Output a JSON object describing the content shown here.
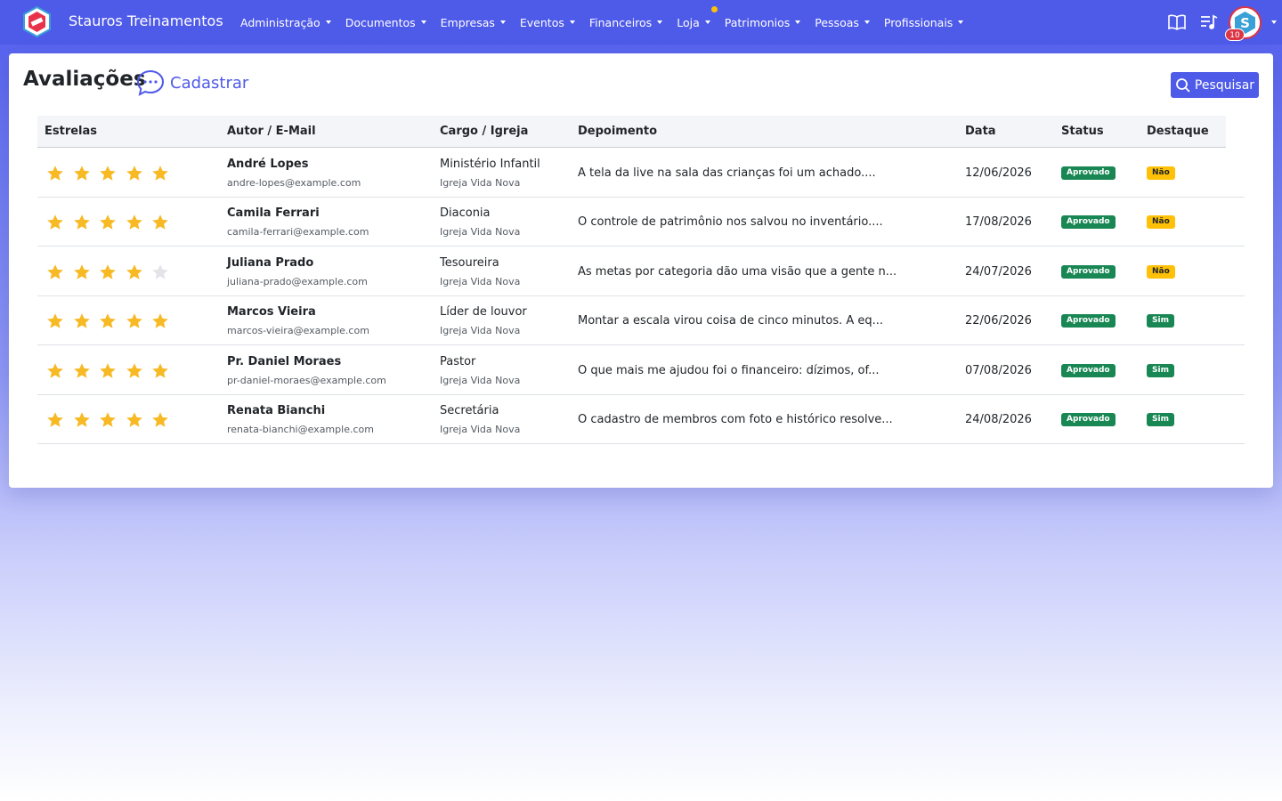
{
  "navbar": {
    "brand": "Stauros Treinamentos",
    "menu": [
      {
        "label": "Administração",
        "name": "nav-administracao"
      },
      {
        "label": "Documentos",
        "name": "nav-documentos"
      },
      {
        "label": "Empresas",
        "name": "nav-empresas"
      },
      {
        "label": "Eventos",
        "name": "nav-eventos"
      },
      {
        "label": "Financeiros",
        "name": "nav-financeiros"
      },
      {
        "label": "Loja",
        "name": "nav-loja"
      },
      {
        "label": "Patrimonios",
        "name": "nav-patrimonios"
      },
      {
        "label": "Pessoas",
        "name": "nav-pessoas"
      },
      {
        "label": "Profissionais",
        "name": "nav-profissionais"
      }
    ],
    "right_icons": [
      "book-icon",
      "playlist-icon"
    ],
    "avatar_badge": "10",
    "colors": {
      "bar": "#4e5ae8",
      "badge": "#dc3545",
      "dot": "#ffc107"
    }
  },
  "page": {
    "title": "Avaliações",
    "add_label": "Cadastrar",
    "search_label": "Pesquisar"
  },
  "table": {
    "headers": [
      "Estrelas",
      "Autor / E-Mail",
      "Cargo / Igreja",
      "Depoimento",
      "Data",
      "Status",
      "Destaque"
    ],
    "rows": [
      {
        "stars": 5,
        "author": "André Lopes",
        "email": "andre-lopes@example.com",
        "role": "Ministério Infantil",
        "church": "Igreja Vida Nova",
        "testimony": "A tela da live na sala das crianças foi um achado....",
        "date": "12/06/2026",
        "status": "Aprovado",
        "highlight": "Não"
      },
      {
        "stars": 5,
        "author": "Camila Ferrari",
        "email": "camila-ferrari@example.com",
        "role": "Diaconia",
        "church": "Igreja Vida Nova",
        "testimony": "O controle de patrimônio nos salvou no inventário....",
        "date": "17/08/2026",
        "status": "Aprovado",
        "highlight": "Não"
      },
      {
        "stars": 4,
        "author": "Juliana Prado",
        "email": "juliana-prado@example.com",
        "role": "Tesoureira",
        "church": "Igreja Vida Nova",
        "testimony": "As metas por categoria dão uma visão que a gente n...",
        "date": "24/07/2026",
        "status": "Aprovado",
        "highlight": "Não"
      },
      {
        "stars": 5,
        "author": "Marcos Vieira",
        "email": "marcos-vieira@example.com",
        "role": "Líder de louvor",
        "church": "Igreja Vida Nova",
        "testimony": "Montar a escala virou coisa de cinco minutos. A eq...",
        "date": "22/06/2026",
        "status": "Aprovado",
        "highlight": "Sim"
      },
      {
        "stars": 5,
        "author": "Pr. Daniel Moraes",
        "email": "pr-daniel-moraes@example.com",
        "role": "Pastor",
        "church": "Igreja Vida Nova",
        "testimony": "O que mais me ajudou foi o financeiro: dízimos, of...",
        "date": "07/08/2026",
        "status": "Aprovado",
        "highlight": "Sim"
      },
      {
        "stars": 5,
        "author": "Renata Bianchi",
        "email": "renata-bianchi@example.com",
        "role": "Secretária",
        "church": "Igreja Vida Nova",
        "testimony": "O cadastro de membros com foto e histórico resolve...",
        "date": "24/08/2026",
        "status": "Aprovado",
        "highlight": "Sim"
      }
    ],
    "star_max": 5,
    "colors": {
      "star_on": "#f7b924",
      "star_off": "#e3e4e8",
      "approved": "#198754",
      "no": "#ffc107",
      "yes": "#198754"
    }
  }
}
